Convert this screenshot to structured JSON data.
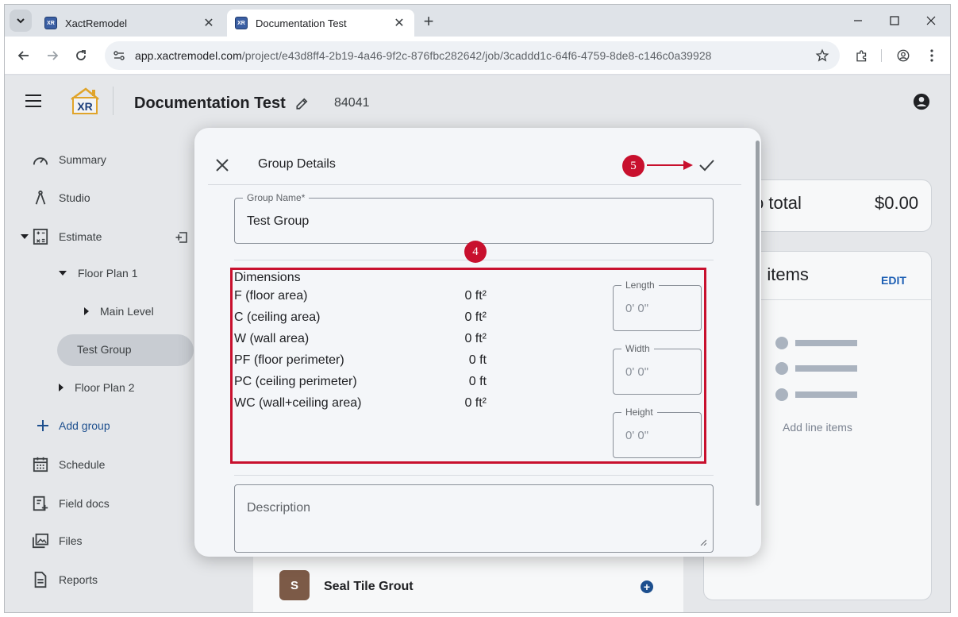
{
  "browser": {
    "tabs": [
      {
        "title": "XactRemodel",
        "active": false
      },
      {
        "title": "Documentation Test",
        "active": true
      }
    ],
    "favicon_text": "XR",
    "url_host": "app.xactremodel.com",
    "url_path": "/project/e43d8ff4-2b19-4a46-9f2c-876fbc282642/job/3caddd1c-64f6-4759-8de8-c146c0a39928"
  },
  "app": {
    "logo_text": "XR",
    "project_title": "Documentation Test",
    "job_number": "84041"
  },
  "sidebar": {
    "summary": "Summary",
    "studio": "Studio",
    "estimate": "Estimate",
    "floor_plan_1": "Floor Plan 1",
    "main_level": "Main Level",
    "test_group": "Test Group",
    "floor_plan_2": "Floor Plan 2",
    "add_group": "Add group",
    "schedule": "Schedule",
    "field_docs": "Field docs",
    "files": "Files",
    "reports": "Reports"
  },
  "right_panel": {
    "total_label": "o total",
    "total_amount": "$0.00",
    "items_title": "d items",
    "edit": "EDIT",
    "empty_text": "Add line items"
  },
  "list_item": {
    "avatar_letter": "S",
    "name": "Seal Tile Grout"
  },
  "dialog": {
    "title": "Group Details",
    "group_name_label": "Group Name*",
    "group_name_value": "Test Group",
    "dimensions_title": "Dimensions",
    "dimensions": [
      {
        "label": "F (floor area)",
        "value": "0 ft²"
      },
      {
        "label": "C (ceiling area)",
        "value": "0 ft²"
      },
      {
        "label": "W (wall area)",
        "value": "0 ft²"
      },
      {
        "label": "PF (floor perimeter)",
        "value": "0 ft"
      },
      {
        "label": "PC (ceiling perimeter)",
        "value": "0 ft"
      },
      {
        "label": "WC (wall+ceiling area)",
        "value": "0 ft²"
      }
    ],
    "length_label": "Length",
    "length_placeholder": "0' 0\"",
    "width_label": "Width",
    "width_placeholder": "0' 0\"",
    "height_label": "Height",
    "height_placeholder": "0' 0\"",
    "description_label": "Description"
  },
  "annotations": {
    "step_4": "4",
    "step_5": "5",
    "color": "#c8102e"
  }
}
